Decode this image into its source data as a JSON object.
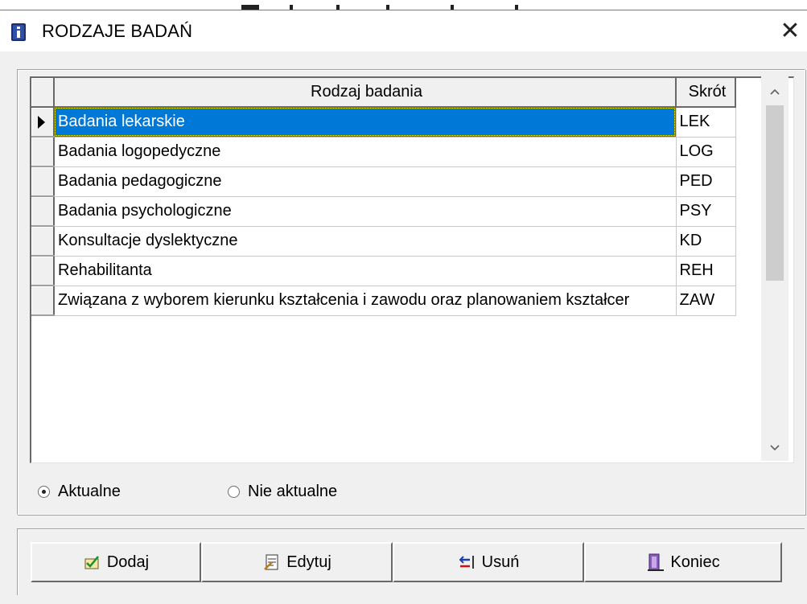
{
  "window": {
    "title": "RODZAJE BADAŃ",
    "close_glyph": "✕",
    "icon": "info-book-icon"
  },
  "grid": {
    "columns": [
      "Rodzaj badania",
      "Skrót"
    ],
    "rows": [
      {
        "name": "Badania lekarskie",
        "code": "LEK",
        "selected": true
      },
      {
        "name": "Badania logopedyczne",
        "code": "LOG"
      },
      {
        "name": "Badania pedagogiczne",
        "code": "PED"
      },
      {
        "name": "Badania psychologiczne",
        "code": "PSY"
      },
      {
        "name": "Konsultacje dyslektyczne",
        "code": "KD"
      },
      {
        "name": "Rehabilitanta",
        "code": "REH"
      },
      {
        "name": "Związana z wyborem kierunku kształcenia i zawodu oraz planowaniem kształcer",
        "code": "ZAW"
      }
    ]
  },
  "filter": {
    "options": [
      {
        "label": "Aktualne",
        "checked": true
      },
      {
        "label": "Nie aktualne",
        "checked": false
      }
    ]
  },
  "buttons": [
    {
      "label": "Dodaj",
      "icon": "add-icon"
    },
    {
      "label": "Edytuj",
      "icon": "edit-icon"
    },
    {
      "label": "Usuń",
      "icon": "delete-icon"
    },
    {
      "label": "Koniec",
      "icon": "exit-door-icon"
    }
  ],
  "colors": {
    "selection": "#0078d7",
    "face": "#f0f0f0",
    "shadow": "#696969"
  }
}
